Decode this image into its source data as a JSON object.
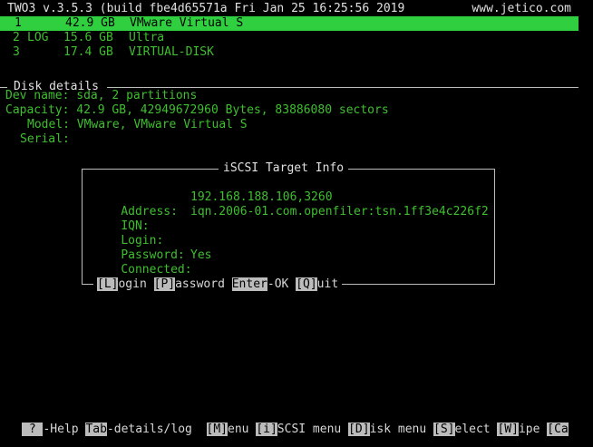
{
  "header": {
    "title": "TWO3 v.3.5.3 (build fbe4d65571a Fri Jan 25 16:25:56 2019",
    "site": "www.jetico.com"
  },
  "disks": [
    {
      "num": "1",
      "tag": "",
      "size": "42.9 GB",
      "name": "VMware Virtual S",
      "selected": true
    },
    {
      "num": "2",
      "tag": "LOG",
      "size": "15.6 GB",
      "name": "Ultra",
      "selected": false
    },
    {
      "num": "3",
      "tag": "",
      "size": "17.4 GB",
      "name": "VIRTUAL-DISK",
      "selected": false
    }
  ],
  "disk_details": {
    "heading": "Disk details",
    "dev_label": "Dev name:",
    "dev_value": "sda, 2 partitions",
    "cap_label": "Capacity:",
    "cap_value": "42.9 GB, 42949672960 Bytes, 83886080 sectors",
    "model_label": "Model:",
    "model_value": "VMware, VMware Virtual S",
    "serial_label": "Serial:",
    "serial_value": ""
  },
  "iscsi": {
    "title": "iSCSI Target Info",
    "address_label": "Address:",
    "address_value": "192.168.188.106,3260",
    "iqn_label": "IQN:",
    "iqn_value": "iqn.2006-01.com.openfiler:tsn.1ff3e4c226f2",
    "login_label": "Login:",
    "login_value": "",
    "password_label": "Password:",
    "password_value": "",
    "connected_label": "Connected:",
    "connected_value": "Yes",
    "actions": {
      "login_key": "[L]",
      "login_text": "ogin ",
      "password_key": "[P]",
      "password_text": "assword ",
      "enter_key": "Enter",
      "enter_text": "-OK ",
      "quit_key": "[Q]",
      "quit_text": "uit"
    }
  },
  "footer": {
    "help_key": " ? ",
    "help_text": "-Help ",
    "tab_key": "Tab",
    "tab_text": "-details/log  ",
    "menu_key": "[M]",
    "menu_text": "enu ",
    "iscsi_key": "[i]",
    "iscsi_text": "SCSI menu ",
    "disk_key": "[D]",
    "disk_text": "isk menu ",
    "select_key": "[S]",
    "select_text": "elect ",
    "wipe_key": "[W]",
    "wipe_text": "ipe ",
    "cancel_key": "[Ca"
  }
}
